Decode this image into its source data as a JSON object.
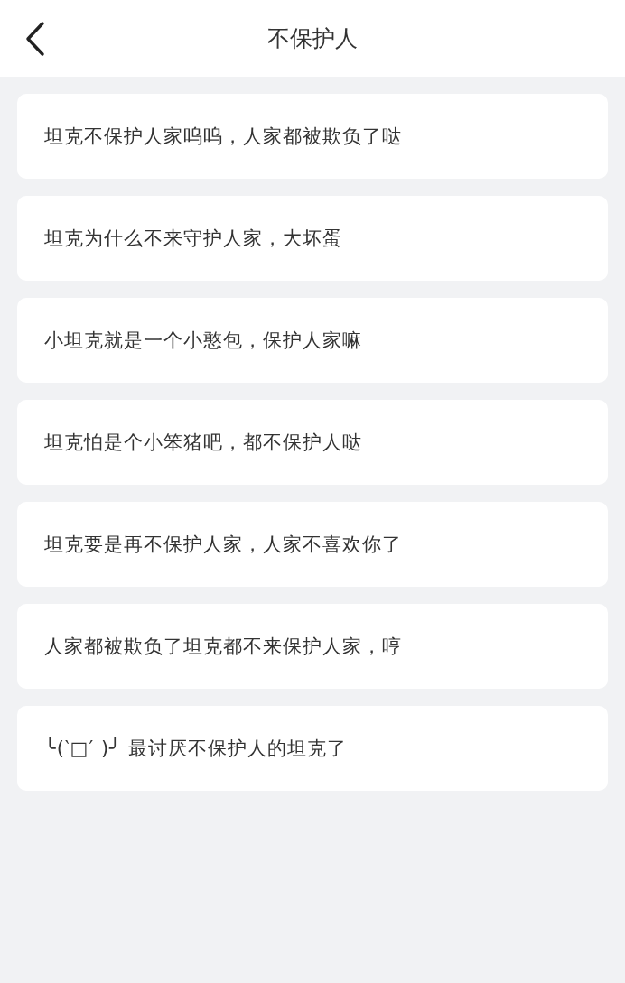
{
  "header": {
    "title": "不保护人"
  },
  "items": [
    "坦克不保护人家呜呜，人家都被欺负了哒",
    "坦克为什么不来守护人家，大坏蛋",
    "小坦克就是一个小憨包，保护人家嘛",
    "坦克怕是个小笨猪吧，都不保护人哒",
    "坦克要是再不保护人家，人家不喜欢你了",
    "人家都被欺负了坦克都不来保护人家，哼",
    "╰(‵□′ )╯ 最讨厌不保护人的坦克了"
  ]
}
